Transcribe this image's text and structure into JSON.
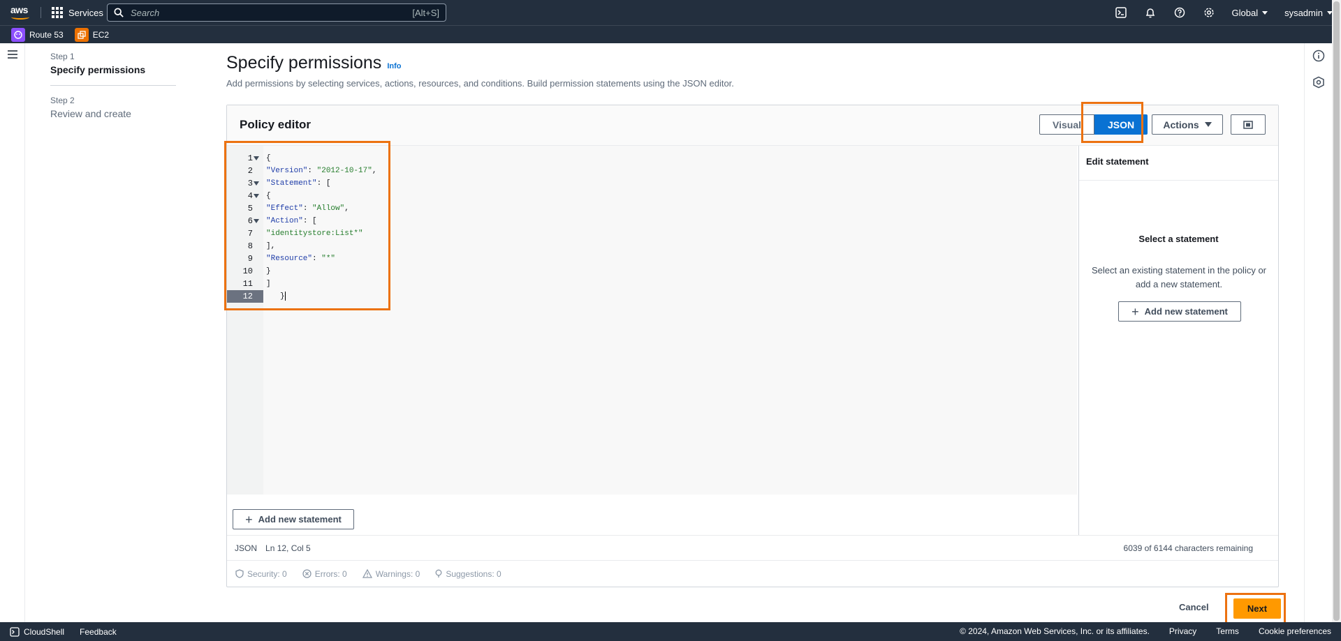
{
  "topnav": {
    "services_label": "Services",
    "search_placeholder": "Search",
    "search_shortcut": "[Alt+S]",
    "region_label": "Global",
    "account_label": "sysadmin"
  },
  "favorites": [
    {
      "label": "Route 53",
      "color": "#8c4fff",
      "icon": "route53-icon"
    },
    {
      "label": "EC2",
      "color": "#ed7100",
      "icon": "ec2-icon"
    }
  ],
  "wizard": {
    "steps": [
      {
        "number": "Step 1",
        "title": "Specify permissions"
      },
      {
        "number": "Step 2",
        "title": "Review and create"
      }
    ]
  },
  "page": {
    "title": "Specify permissions",
    "info_link": "Info",
    "description": "Add permissions by selecting services, actions, resources, and conditions. Build permission statements using the JSON editor."
  },
  "editor": {
    "title": "Policy editor",
    "visual_label": "Visual",
    "json_label": "JSON",
    "actions_label": "Actions",
    "line_numbers": [
      "1",
      "2",
      "3",
      "4",
      "5",
      "6",
      "7",
      "8",
      "9",
      "10",
      "11",
      "12"
    ],
    "add_statement_label": "Add new statement",
    "status_mode": "JSON",
    "status_position": "Ln 12, Col 5",
    "chars_remaining": "6039 of 6144 characters remaining",
    "diagnostics": {
      "security": "Security: 0",
      "errors": "Errors: 0",
      "warnings": "Warnings: 0",
      "suggestions": "Suggestions: 0"
    }
  },
  "code": {
    "line1": "{",
    "version_key": "\"Version\"",
    "version_val": "\"2012-10-17\"",
    "statement_key": "\"Statement\"",
    "line4": "{",
    "effect_key": "\"Effect\"",
    "effect_val": "\"Allow\"",
    "action_key": "\"Action\"",
    "action_val": "\"identitystore:List*\"",
    "line8": "],",
    "resource_key": "\"Resource\"",
    "resource_val": "\"*\"",
    "line10": "}",
    "line11": "]",
    "line12": "}"
  },
  "right_panel": {
    "header": "Edit statement",
    "select_title": "Select a statement",
    "select_desc": "Select an existing statement in the policy or add a new statement.",
    "add_statement_label": "Add new statement"
  },
  "footer_actions": {
    "cancel_label": "Cancel",
    "next_label": "Next"
  },
  "console_footer": {
    "cloudshell": "CloudShell",
    "feedback": "Feedback",
    "copyright": "© 2024, Amazon Web Services, Inc. or its affiliates.",
    "privacy": "Privacy",
    "terms": "Terms",
    "cookie": "Cookie preferences"
  },
  "colors": {
    "nav_bg": "#232f3e",
    "accent_blue": "#0972d3",
    "primary_orange": "#ff9900",
    "highlight_orange": "#ec7211"
  }
}
